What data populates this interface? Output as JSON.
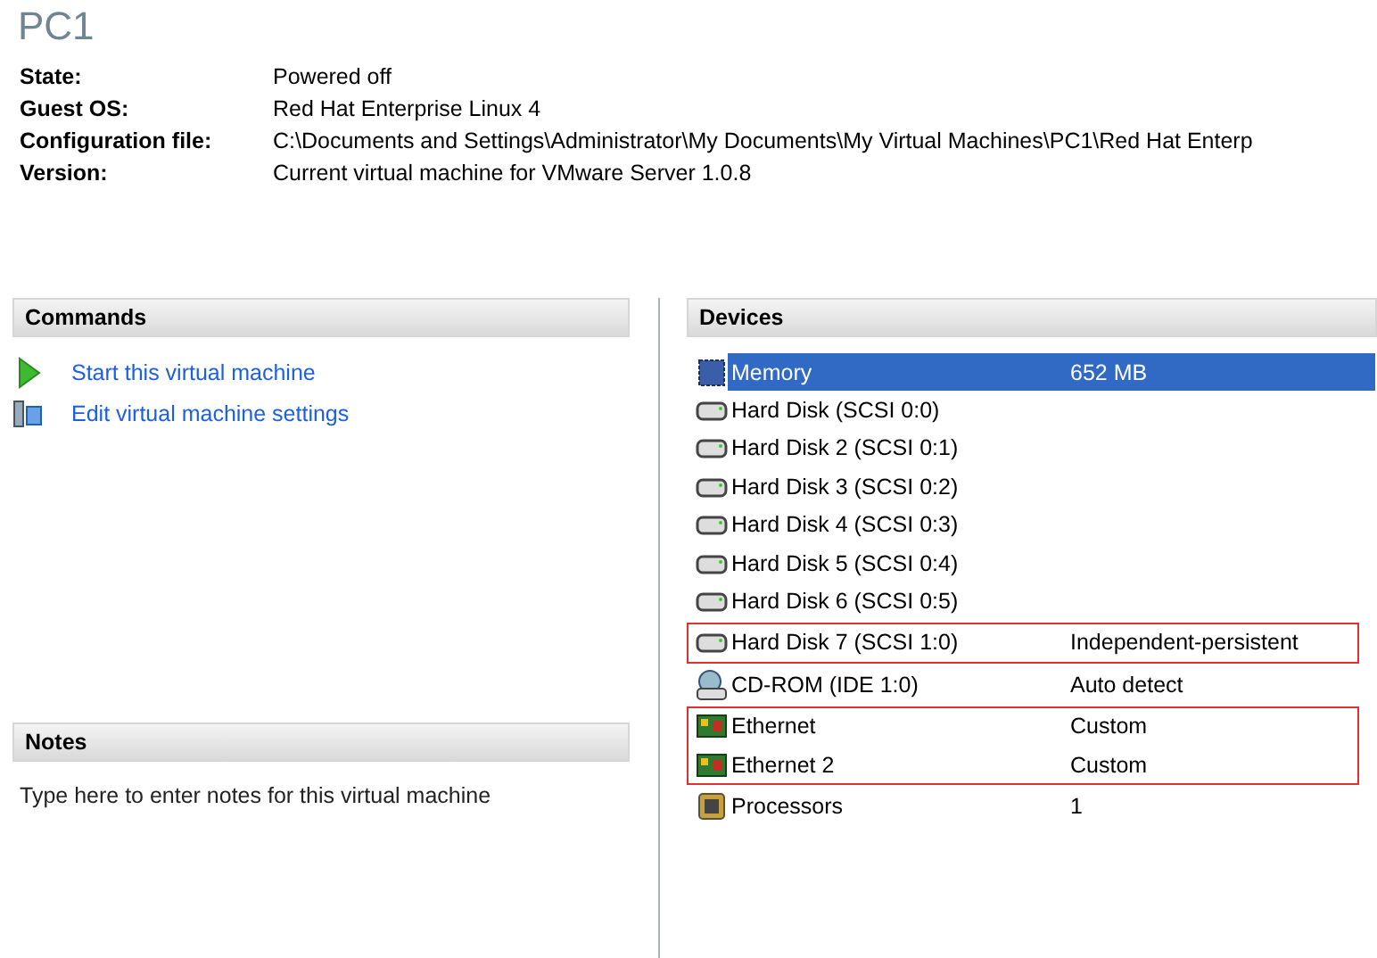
{
  "title": "PC1",
  "info": [
    {
      "label": "State:",
      "value": "Powered off"
    },
    {
      "label": "Guest OS:",
      "value": "Red Hat Enterprise Linux 4"
    },
    {
      "label": "Configuration file:",
      "value": "C:\\Documents and Settings\\Administrator\\My Documents\\My Virtual Machines\\PC1\\Red Hat Enterp"
    },
    {
      "label": "Version:",
      "value": "Current virtual machine for VMware Server 1.0.8"
    }
  ],
  "commands": {
    "heading": "Commands",
    "items": [
      {
        "kind": "start",
        "label": "Start this virtual machine"
      },
      {
        "kind": "edit",
        "label": "Edit virtual machine settings"
      }
    ]
  },
  "notes": {
    "heading": "Notes",
    "placeholder": "Type here to enter notes for this virtual machine"
  },
  "devices": {
    "heading": "Devices",
    "groups": [
      {
        "outlined": false,
        "items": [
          {
            "kind": "memory",
            "name": "Memory",
            "value": "652 MB",
            "selected": true
          },
          {
            "kind": "disk",
            "name": "Hard Disk (SCSI 0:0)",
            "selected": false
          },
          {
            "kind": "disk",
            "name": "Hard Disk 2 (SCSI 0:1)",
            "selected": false
          },
          {
            "kind": "disk",
            "name": "Hard Disk 3 (SCSI 0:2)",
            "selected": false
          },
          {
            "kind": "disk",
            "name": "Hard Disk 4 (SCSI 0:3)",
            "selected": false
          },
          {
            "kind": "disk",
            "name": "Hard Disk 5 (SCSI 0:4)",
            "selected": false
          },
          {
            "kind": "disk",
            "name": "Hard Disk 6 (SCSI 0:5)",
            "selected": false
          }
        ]
      },
      {
        "outlined": true,
        "items": [
          {
            "kind": "disk",
            "name": "Hard Disk 7 (SCSI 1:0)",
            "value": "Independent-persistent",
            "selected": false
          }
        ]
      },
      {
        "outlined": false,
        "items": [
          {
            "kind": "cdrom",
            "name": "CD-ROM (IDE 1:0)",
            "value": "Auto detect",
            "selected": false
          }
        ]
      },
      {
        "outlined": true,
        "items": [
          {
            "kind": "ethernet",
            "name": "Ethernet",
            "value": "Custom",
            "selected": false
          },
          {
            "kind": "ethernet",
            "name": "Ethernet 2",
            "value": "Custom",
            "selected": false
          }
        ]
      },
      {
        "outlined": false,
        "items": [
          {
            "kind": "processor",
            "name": "Processors",
            "value": "1",
            "selected": false
          }
        ]
      }
    ]
  }
}
